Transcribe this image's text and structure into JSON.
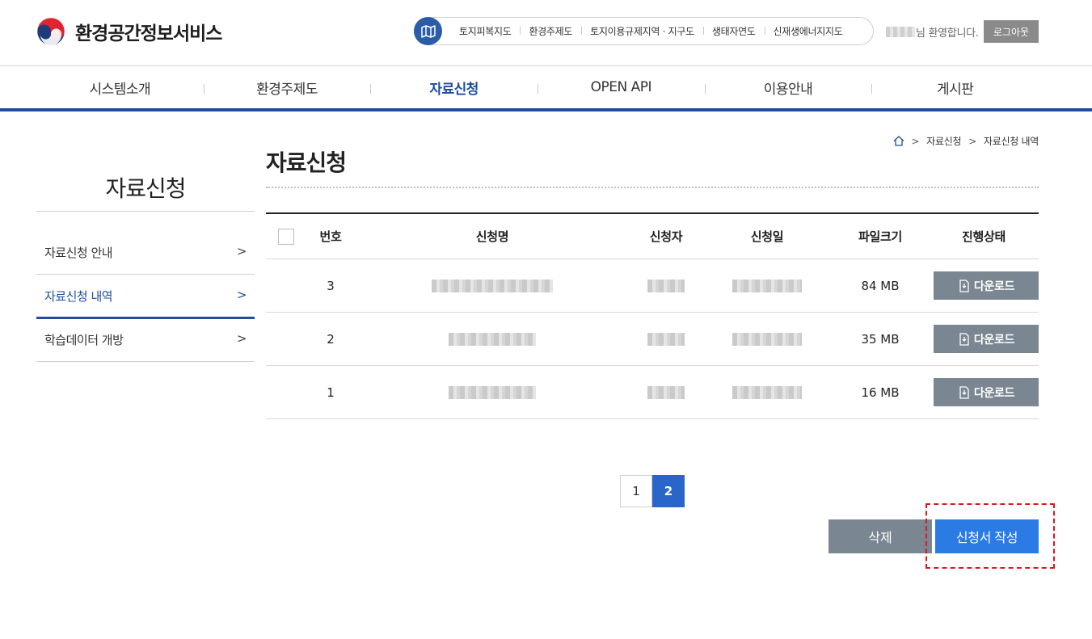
{
  "header": {
    "site_title": "환경공간정보서비스",
    "map_links": [
      "토지피복지도",
      "환경주제도",
      "토지이용규제지역 · 지구도",
      "생태자연도",
      "신재생에너지지도"
    ],
    "welcome_suffix": "님 환영합니다.",
    "logout_label": "로그아웃"
  },
  "gnb": [
    "시스템소개",
    "환경주제도",
    "자료신청",
    "OPEN API",
    "이용안내",
    "게시판"
  ],
  "gnb_active": "자료신청",
  "lnb": {
    "title": "자료신청",
    "items": [
      "자료신청 안내",
      "자료신청 내역",
      "학습데이터 개방"
    ],
    "arrow": ">"
  },
  "breadcrumb": [
    "자료신청",
    "자료신청 내역"
  ],
  "breadcrumb_sep": ">",
  "page_title": "자료신청",
  "table": {
    "headers": [
      "번호",
      "신청명",
      "신청자",
      "신청일",
      "파일크기",
      "진행상태"
    ],
    "rows": [
      {
        "no": "3",
        "size": "84 MB",
        "status": "다운로드"
      },
      {
        "no": "2",
        "size": "35 MB",
        "status": "다운로드"
      },
      {
        "no": "1",
        "size": "16 MB",
        "status": "다운로드"
      }
    ]
  },
  "pagination": {
    "pages": [
      "1",
      "2"
    ],
    "current": "2"
  },
  "actions": {
    "delete_label": "삭제",
    "write_label": "신청서 작성"
  },
  "colors": {
    "primary": "#1f4e9a",
    "button_blue": "#2a7be4",
    "button_gray": "#7a8691",
    "highlight": "#e0161b"
  }
}
